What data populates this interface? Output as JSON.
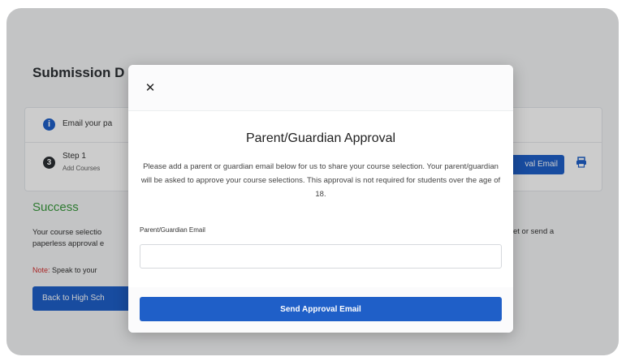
{
  "page": {
    "title": "Submission D",
    "info_text": "Email your pa",
    "step_title": "Step 1",
    "step_subtitle": "Add Courses",
    "step_number": "3",
    "email_button_label": "val Email",
    "success_heading": "Success",
    "success_text_line1": "Your course selectio",
    "success_text_line2": "paperless approval e",
    "success_text_right": "et or send a",
    "note_label": "Note:",
    "note_text": " Speak to your",
    "back_button_label": "Back to High Sch"
  },
  "modal": {
    "close_icon": "✕",
    "title": "Parent/Guardian Approval",
    "description": "Please add a parent or guardian email below for us to share your course selection. Your parent/guardian will be asked to approve your course selections. This approval is not required for students over the age of 18.",
    "email_label": "Parent/Guardian Email",
    "email_value": "",
    "email_placeholder": "",
    "send_button_label": "Send Approval Email"
  },
  "colors": {
    "primary": "#1f5fc8",
    "success": "#3a9a3e",
    "note": "#d32f2f"
  },
  "icons": {
    "info": "info-icon",
    "print": "print-icon",
    "close": "close-icon"
  }
}
